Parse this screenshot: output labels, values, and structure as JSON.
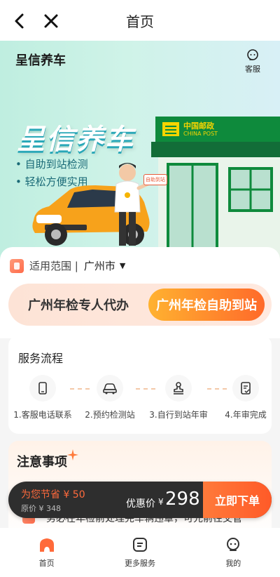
{
  "topbar": {
    "title": "首页",
    "back_icon": "chevron-left-icon",
    "close_icon": "close-icon"
  },
  "hero": {
    "brand": "呈信养车",
    "cs_label": "客服",
    "big_title": "呈信养车",
    "feature_1": "• 自助到站检测",
    "feature_2": "• 轻松方便实用",
    "post_logo_cn": "中国邮政",
    "post_logo_en": "CHINA POST",
    "sign_text": "自助到站"
  },
  "scope": {
    "label": "适用范围 |",
    "city": "广州市"
  },
  "service_switch": {
    "left": "广州年检专人代办",
    "right": "广州年检自助到站"
  },
  "process": {
    "title": "服务流程",
    "steps": [
      {
        "label": "1.客服电话联系",
        "icon": "phone-icon"
      },
      {
        "label": "2.预约检测站",
        "icon": "car-icon"
      },
      {
        "label": "3.自行到站年审",
        "icon": "stamp-icon"
      },
      {
        "label": "4.年审完成",
        "icon": "document-check-icon"
      }
    ]
  },
  "notice": {
    "title": "注意事项",
    "line_1": "务必在年检前处理完车辆违章，可先前往交管"
  },
  "paybar": {
    "save_text": "为您节省 ¥ 50",
    "original_text": "原价 ¥ 348",
    "price_label": "优惠价",
    "price_symbol": "¥",
    "price_value": "298",
    "buy_label": "立即下单"
  },
  "tabbar": {
    "items": [
      {
        "label": "首页",
        "icon": "home-icon",
        "active": true
      },
      {
        "label": "更多服务",
        "icon": "service-list-icon",
        "active": false
      },
      {
        "label": "我的",
        "icon": "user-icon",
        "active": false
      }
    ]
  },
  "colors": {
    "accent": "#ff6a2a",
    "hero_bg": "#c9f0e6",
    "post_green": "#0e8a3c"
  }
}
